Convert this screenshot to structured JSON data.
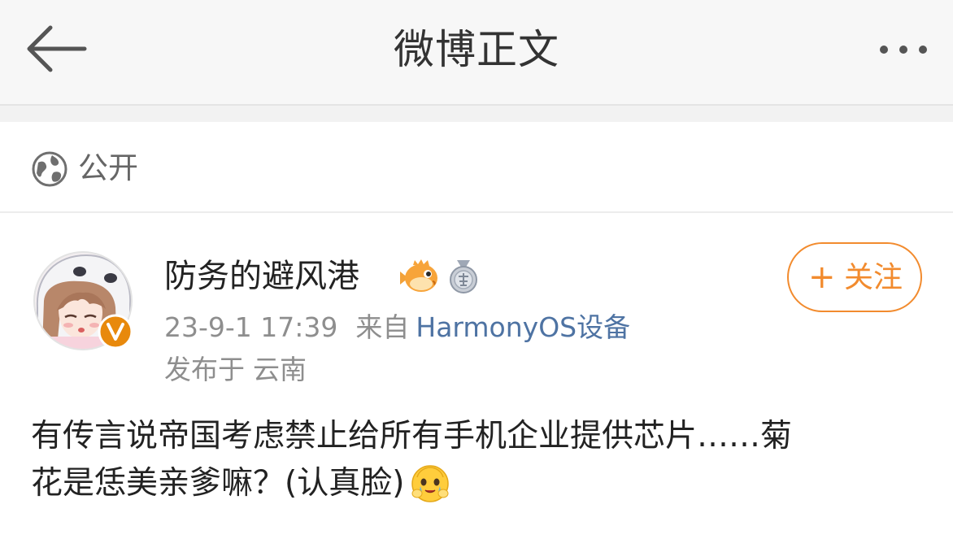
{
  "header": {
    "title": "微博正文",
    "back_icon": "arrow-left-icon",
    "more_icon": "more-dots-icon"
  },
  "visibility": {
    "icon": "globe-icon",
    "label": "公开"
  },
  "post": {
    "author": {
      "name": "防务的避风港",
      "avatar": "anime-girl-avatar",
      "verified_badge": "V",
      "badges": [
        "pufferfish-vip-icon",
        "medal-icon"
      ]
    },
    "time": "23-9-1 17:39",
    "source_prefix": "来自",
    "source_device": "HarmonyOS设备",
    "location_prefix": "发布于",
    "location": "云南",
    "follow_button": {
      "plus": "+",
      "label": "关注"
    },
    "text_lines": [
      "有传言说帝国考虑禁止给所有手机企业提供芯片……菊",
      "花是恁美亲爹嘛？(认真脸)"
    ],
    "emoji": "crying-face-emoji"
  },
  "colors": {
    "accent_orange": "#f28b2e",
    "link_blue": "#4e73a3",
    "meta_gray": "#8e8e8e",
    "header_bg": "#f7f7f7",
    "verified_badge": "#e8890c"
  }
}
